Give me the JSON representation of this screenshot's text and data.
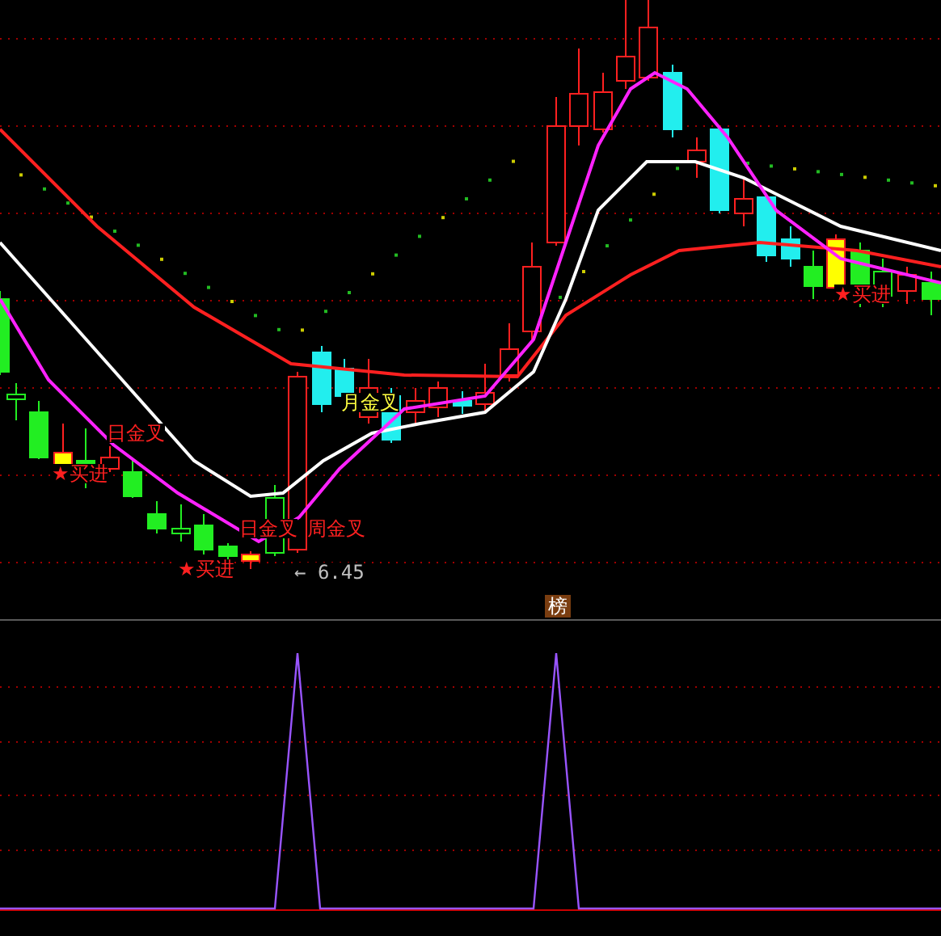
{
  "main_chart": {
    "annotations": [
      {
        "kind": "cross",
        "text": "日金叉",
        "color": "#ff2020"
      },
      {
        "kind": "buy",
        "text": "★买进",
        "color": "#ff2020"
      },
      {
        "kind": "cross",
        "text": "日金叉",
        "color": "#ff2020"
      },
      {
        "kind": "cross",
        "text": "周金叉",
        "color": "#ff2020"
      },
      {
        "kind": "buy",
        "text": "★买进",
        "color": "#ff2020"
      },
      {
        "kind": "price",
        "text": "← 6.45",
        "color": "#c0c0c0"
      },
      {
        "kind": "cross",
        "text": "月金叉",
        "color": "#ffff40"
      },
      {
        "kind": "buy",
        "text": "★买进",
        "color": "#ff2020"
      }
    ]
  },
  "indicator_panel": {
    "badge": "榜"
  }
}
